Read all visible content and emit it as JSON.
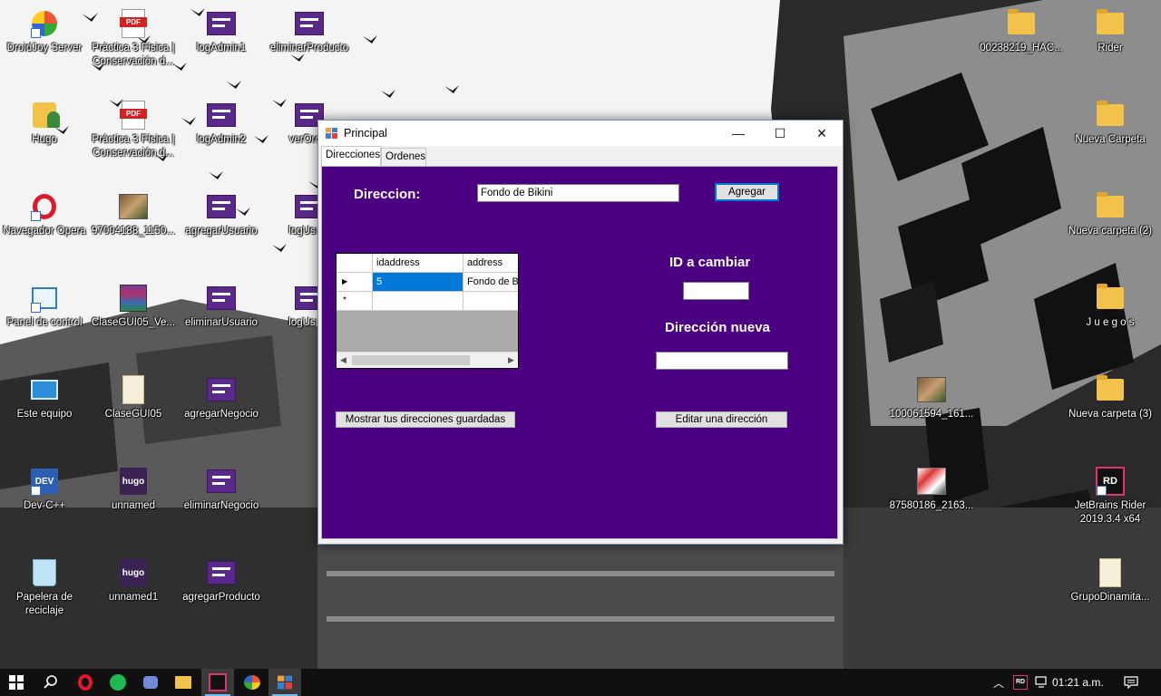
{
  "desktop": {
    "icons": [
      {
        "id": "droidjoy",
        "label": "DroidJoy Server"
      },
      {
        "id": "practica1",
        "label": "Práctica 3 Física | Conservación d..."
      },
      {
        "id": "logadmin1",
        "label": "logAdmin1"
      },
      {
        "id": "eliminarproducto",
        "label": "eliminarProducto"
      },
      {
        "id": "hugo",
        "label": "Hugo"
      },
      {
        "id": "practica2",
        "label": "Práctica 3 Física | Conservación d..."
      },
      {
        "id": "logadmin2",
        "label": "logAdmin2"
      },
      {
        "id": "verord",
        "label": "verOrd..."
      },
      {
        "id": "opera",
        "label": "Navegador Opera"
      },
      {
        "id": "img97004",
        "label": "97004188_1150..."
      },
      {
        "id": "agregarusuario",
        "label": "agregarUsuario"
      },
      {
        "id": "logusu1",
        "label": "logUsu..."
      },
      {
        "id": "panel",
        "label": "Panel de control"
      },
      {
        "id": "clasegui_rar",
        "label": "ClaseGUI05_Ve..."
      },
      {
        "id": "eliminarusuario",
        "label": "eliminarUsuario"
      },
      {
        "id": "logusu2",
        "label": "logUsu..."
      },
      {
        "id": "esteequipo",
        "label": "Este equipo"
      },
      {
        "id": "clasegui05",
        "label": "ClaseGUI05"
      },
      {
        "id": "agregarnegocio",
        "label": "agregarNegocio"
      },
      {
        "id": "devcpp",
        "label": "Dev-C++"
      },
      {
        "id": "unnamed",
        "label": "unnamed"
      },
      {
        "id": "eliminarnegocio",
        "label": "eliminarNegocio"
      },
      {
        "id": "papelera",
        "label": "Papelera de reciclaje"
      },
      {
        "id": "unnamed1",
        "label": "unnamed1"
      },
      {
        "id": "agregarproducto",
        "label": "agregarProducto"
      },
      {
        "id": "hac",
        "label": "00238219_HAC..."
      },
      {
        "id": "rider",
        "label": "Rider"
      },
      {
        "id": "nuevacarpeta",
        "label": "Nueva Carpeta"
      },
      {
        "id": "nuevacarpeta2",
        "label": "Nueva carpeta (2)"
      },
      {
        "id": "juegos",
        "label": "J u e g o s"
      },
      {
        "id": "img100061",
        "label": "100061594_161..."
      },
      {
        "id": "nuevacarpeta3",
        "label": "Nueva carpeta (3)"
      },
      {
        "id": "img87580",
        "label": "87580186_2163..."
      },
      {
        "id": "jetbrains",
        "label": "JetBrains Rider 2019.3.4 x64"
      },
      {
        "id": "grupodinamita",
        "label": "GrupoDinamita..."
      }
    ],
    "icon_glyphs": {
      "hugo_tile": "hugo",
      "dev_tile": "DEV",
      "rd_tile": "RD"
    }
  },
  "window": {
    "title": "Principal",
    "controls": {
      "minimize": "—",
      "maximize": "☐",
      "close": "✕"
    },
    "tabs": [
      {
        "label": "Direcciones",
        "active": true
      },
      {
        "label": "Ordenes",
        "active": false
      }
    ],
    "direcciones": {
      "direccion_label": "Direccion:",
      "direccion_value": "Fondo de Bikini",
      "agregar_button": "Agregar",
      "id_label": "ID a cambiar",
      "id_value": "",
      "nueva_label": "Dirección nueva",
      "nueva_value": "",
      "mostrar_button": "Mostrar tus direcciones guardadas",
      "editar_button": "Editar una dirección",
      "grid": {
        "columns": [
          "idaddress",
          "address"
        ],
        "rows": [
          {
            "idaddress": "5",
            "address": "Fondo de B"
          }
        ],
        "current_row_marker": "▶",
        "new_row_marker": "*"
      }
    }
  },
  "taskbar": {
    "clock": "01:21 a.m.",
    "tray_rd": "RD",
    "accent": "#76b9ed"
  },
  "colors": {
    "form_background": "#4b0082",
    "selection": "#0078d7"
  }
}
